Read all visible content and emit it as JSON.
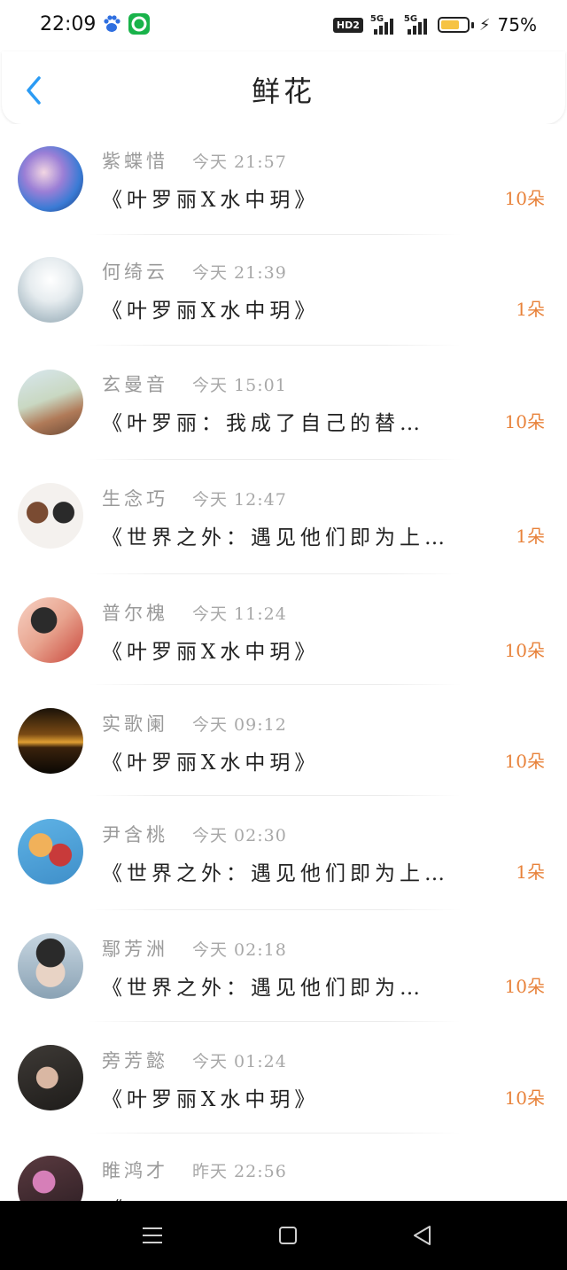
{
  "status_bar": {
    "time": "22:09",
    "hd_label": "HD2",
    "network_1": "5G",
    "network_2": "5G",
    "battery_percent": "75%",
    "battery_level": 0.75
  },
  "header": {
    "title": "鲜花"
  },
  "list": [
    {
      "name": "紫蝶惜",
      "time": "今天 21:57",
      "book": "《叶罗丽X水中玥》",
      "count": "10朵"
    },
    {
      "name": "何绮云",
      "time": "今天 21:39",
      "book": "《叶罗丽X水中玥》",
      "count": "1朵"
    },
    {
      "name": "玄曼音",
      "time": "今天 15:01",
      "book": "《叶罗丽：我成了自己的替…",
      "count": "10朵"
    },
    {
      "name": "生念巧",
      "time": "今天 12:47",
      "book": "《世界之外：遇见他们即为上…",
      "count": "1朵"
    },
    {
      "name": "普尔槐",
      "time": "今天 11:24",
      "book": "《叶罗丽X水中玥》",
      "count": "10朵"
    },
    {
      "name": "实歌阑",
      "time": "今天 09:12",
      "book": "《叶罗丽X水中玥》",
      "count": "10朵"
    },
    {
      "name": "尹含桃",
      "time": "今天 02:30",
      "book": "《世界之外：遇见他们即为上…",
      "count": "1朵"
    },
    {
      "name": "鄢芳洲",
      "time": "今天 02:18",
      "book": "《世界之外：遇见他们即为…",
      "count": "10朵"
    },
    {
      "name": "旁芳懿",
      "time": "今天 01:24",
      "book": "《叶罗丽X水中玥》",
      "count": "10朵"
    },
    {
      "name": "睢鸿才",
      "time": "昨天 22:56",
      "book": "《…",
      "count": ""
    }
  ],
  "colors": {
    "accent_blue": "#2b9bf4",
    "count_orange": "#e8823a",
    "name_gray": "#9a9a9a"
  }
}
